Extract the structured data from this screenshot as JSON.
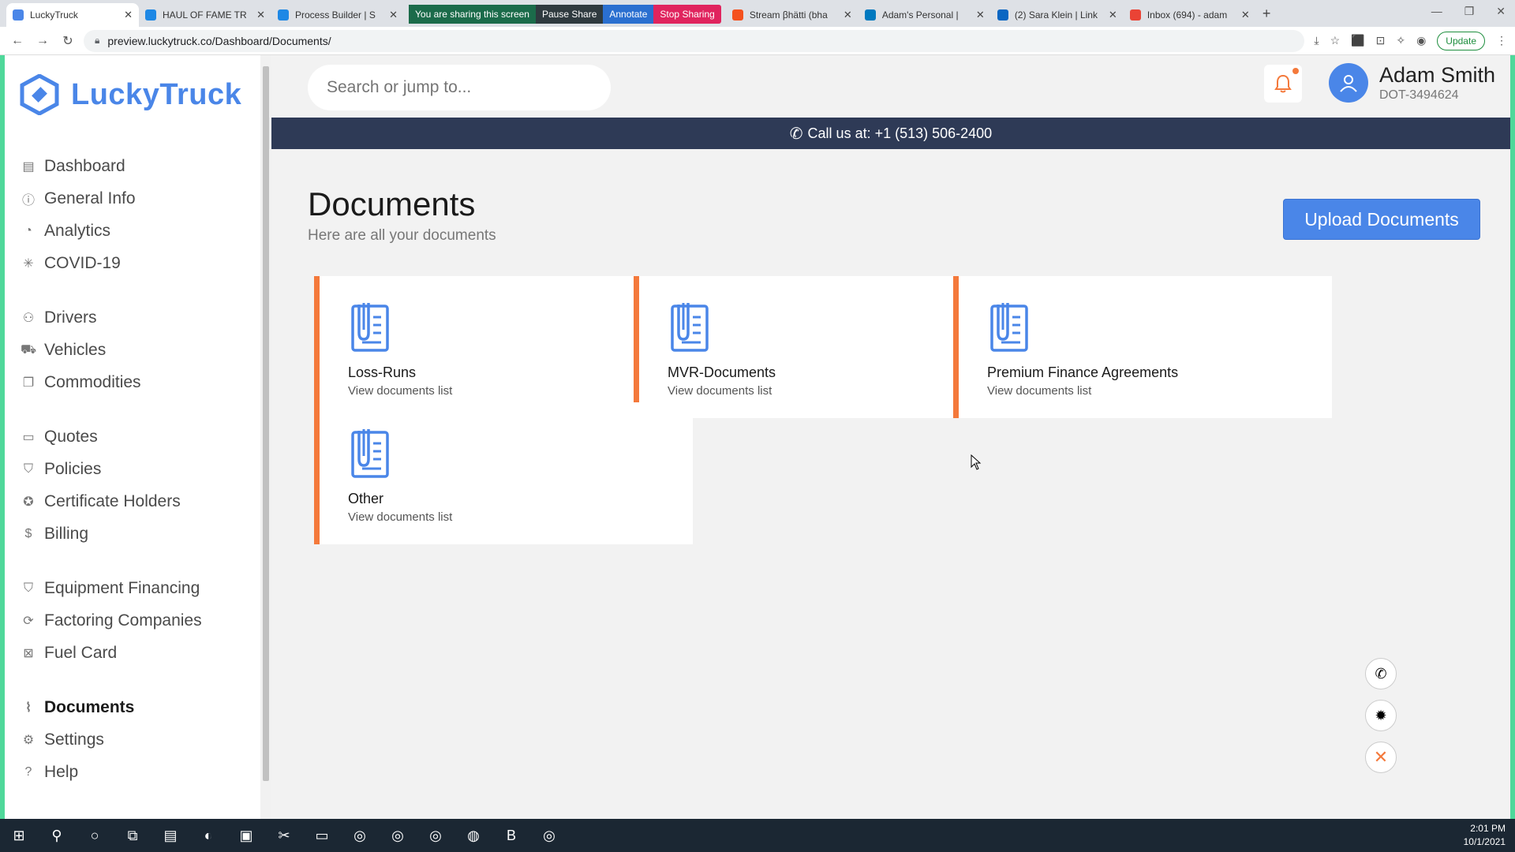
{
  "browser": {
    "tabs": [
      {
        "title": "LuckyTruck",
        "color": "#4a86e8",
        "active": true
      },
      {
        "title": "HAUL OF FAME TR",
        "color": "#1e88e5"
      },
      {
        "title": "Process Builder | S",
        "color": "#1e88e5"
      }
    ],
    "share": {
      "message": "You are sharing this screen",
      "pause": "Pause Share",
      "annotate": "Annotate",
      "stop": "Stop Sharing"
    },
    "tabs_right": [
      {
        "title": "Stream βhätti (bha",
        "color": "#f4511e"
      },
      {
        "title": "Adam's Personal |",
        "color": "#0079bf"
      },
      {
        "title": "(2) Sara Klein | Link",
        "color": "#0a66c2"
      },
      {
        "title": "Inbox (694) - adam",
        "color": "#ea4335"
      }
    ],
    "url": "preview.luckytruck.co/Dashboard/Documents/",
    "update_label": "Update"
  },
  "sidebar": {
    "brand": "LuckyTruck",
    "groups": [
      [
        {
          "label": "Dashboard",
          "icon": "dashboard-icon",
          "glyph": "▤"
        },
        {
          "label": "General Info",
          "icon": "info-icon",
          "glyph": "ⓘ"
        },
        {
          "label": "Analytics",
          "icon": "pie-chart-icon",
          "glyph": "◔"
        },
        {
          "label": "COVID-19",
          "icon": "virus-icon",
          "glyph": "✳"
        }
      ],
      [
        {
          "label": "Drivers",
          "icon": "user-icon",
          "glyph": "⚇"
        },
        {
          "label": "Vehicles",
          "icon": "truck-icon",
          "glyph": "⛟"
        },
        {
          "label": "Commodities",
          "icon": "box-icon",
          "glyph": "❐"
        }
      ],
      [
        {
          "label": "Quotes",
          "icon": "message-icon",
          "glyph": "▭"
        },
        {
          "label": "Policies",
          "icon": "shield-check-icon",
          "glyph": "⛉"
        },
        {
          "label": "Certificate Holders",
          "icon": "award-icon",
          "glyph": "✪"
        },
        {
          "label": "Billing",
          "icon": "dollar-icon",
          "glyph": "$"
        }
      ],
      [
        {
          "label": "Equipment Financing",
          "icon": "shield-icon",
          "glyph": "⛉"
        },
        {
          "label": "Factoring Companies",
          "icon": "refresh-icon",
          "glyph": "⟳"
        },
        {
          "label": "Fuel Card",
          "icon": "card-icon",
          "glyph": "⊠"
        }
      ],
      [
        {
          "label": "Documents",
          "icon": "paperclip-icon",
          "glyph": "⌇",
          "active": true
        },
        {
          "label": "Settings",
          "icon": "gear-icon",
          "glyph": "⚙"
        },
        {
          "label": "Help",
          "icon": "help-icon",
          "glyph": "?"
        }
      ]
    ]
  },
  "topbar": {
    "search_placeholder": "Search or jump to...",
    "user_name": "Adam Smith",
    "user_dot": "DOT-3494624"
  },
  "callbar": {
    "text": "Call us at: +1 (513) 506-2400"
  },
  "page": {
    "title": "Documents",
    "subtitle": "Here are all your documents",
    "upload_label": "Upload Documents"
  },
  "cards": [
    {
      "title": "Loss-Runs",
      "sub": "View documents list"
    },
    {
      "title": "MVR-Documents",
      "sub": "View documents list"
    },
    {
      "title": "Premium Finance Agreements",
      "sub": "View documents list"
    },
    {
      "title": "Other",
      "sub": "View documents list"
    }
  ],
  "taskbar": {
    "time": "2:01 PM",
    "date": "10/1/2021"
  },
  "colors": {
    "accent": "#4a86e8",
    "card_border": "#f4793b",
    "callbar": "#2e3a56"
  }
}
